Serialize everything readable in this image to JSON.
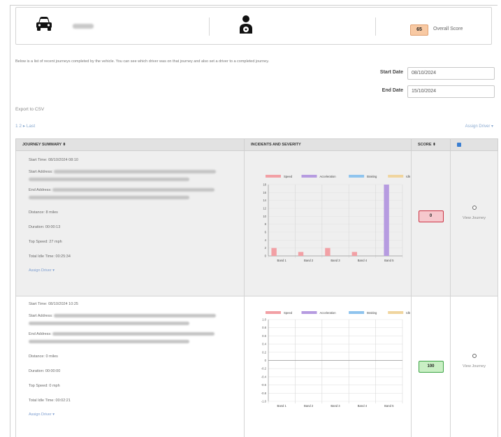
{
  "header": {
    "vehicle_icon": "car-icon",
    "driver_icon": "driver-icon",
    "overall_score": "65",
    "overall_score_label": "Overall Score"
  },
  "intro_text": "Below is a list of recent journeys completed by the vehicle. You can see which driver was on that journey and also set a driver to a completed journey.",
  "filters": {
    "start_date_label": "Start Date",
    "start_date": "08/10/2024",
    "end_date_label": "End Date",
    "end_date": "15/10/2024"
  },
  "export_label": "Export to CSV",
  "pager": "1 2 ▸ Last",
  "assign_driver_top": "Assign Driver ▾",
  "table": {
    "headers": [
      "JOURNEY SUMMARY ⬍",
      "INCIDENTS AND SEVERITY",
      "SCORE ⬍"
    ],
    "rows": [
      {
        "start_time": "Start Time: 08/10/2024 08:10",
        "start_address_label": "Start Address:",
        "end_address_label": "End Address:",
        "distance": "Distance: 8 miles",
        "duration": "Duration: 00:00:13",
        "top_speed": "Top Speed: 27 mph",
        "idle_time": "Total Idle Time: 00:25:34",
        "assign_driver": "Assign Driver ▾",
        "score": "0",
        "view_journey": "View Journey"
      },
      {
        "start_time": "Start Time: 08/10/2024 10:25",
        "start_address_label": "Start Address:",
        "end_address_label": "End Address:",
        "distance": "Distance: 0 miles",
        "duration": "Duration: 00:00:00",
        "top_speed": "Top Speed: 0 mph",
        "idle_time": "Total Idle Time: 00:02:21",
        "assign_driver": "Assign Driver ▾",
        "score": "100",
        "view_journey": "View Journey"
      }
    ]
  },
  "chart_data": [
    {
      "type": "bar",
      "categories": [
        "Band 1",
        "Band 2",
        "Band 3",
        "Band 4",
        "Band 5"
      ],
      "series": [
        {
          "name": "Speed",
          "color": "#f2a0a5",
          "values": [
            2,
            1,
            2,
            1,
            0
          ]
        },
        {
          "name": "Acceleration",
          "color": "#b69be0",
          "values": [
            0,
            0,
            0,
            0,
            18
          ]
        },
        {
          "name": "Braking",
          "color": "#8fc4ee",
          "values": [
            0,
            0,
            0,
            0,
            0
          ]
        },
        {
          "name": "Idle",
          "color": "#f0d59f",
          "values": [
            0,
            0,
            0,
            0,
            0
          ]
        }
      ],
      "ylim": [
        0,
        18
      ],
      "yticks": [
        "0",
        "2",
        "4",
        "6",
        "8",
        "10",
        "12",
        "14",
        "16",
        "18"
      ],
      "grid": true,
      "legend": "top"
    },
    {
      "type": "bar",
      "categories": [
        "Band 1",
        "Band 2",
        "Band 3",
        "Band 4",
        "Band 5"
      ],
      "series": [
        {
          "name": "Speed",
          "color": "#f2a0a5",
          "values": [
            0,
            0,
            0,
            0,
            0
          ]
        },
        {
          "name": "Acceleration",
          "color": "#b69be0",
          "values": [
            0,
            0,
            0,
            0,
            0
          ]
        },
        {
          "name": "Braking",
          "color": "#8fc4ee",
          "values": [
            0,
            0,
            0,
            0,
            0
          ]
        },
        {
          "name": "Idle",
          "color": "#f0d59f",
          "values": [
            0,
            0,
            0,
            0,
            0
          ]
        }
      ],
      "ylim": [
        -1.0,
        1.0
      ],
      "yticks": [
        "1.0",
        "0.8",
        "0.6",
        "0.4",
        "0.2",
        "0",
        "-0.2",
        "-0.4",
        "-0.6",
        "-0.8",
        "-1.0"
      ],
      "grid": true,
      "legend": "top"
    }
  ]
}
